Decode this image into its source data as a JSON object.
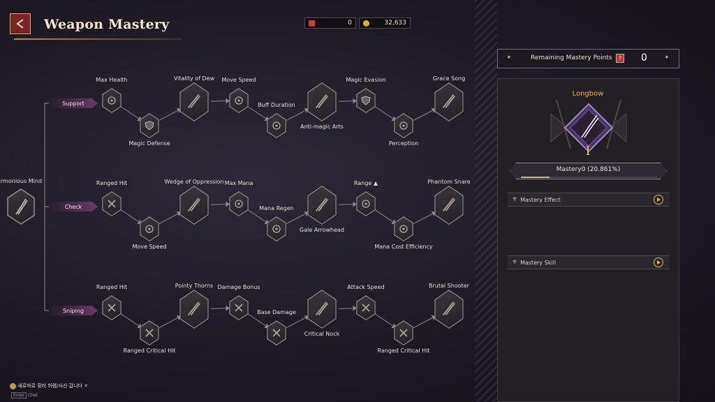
{
  "header": {
    "title": "Weapon Mastery"
  },
  "currencies": [
    {
      "icon": "feather-icon",
      "value": "0",
      "color": "#c04040"
    },
    {
      "icon": "gold-coin-icon",
      "value": "32,633",
      "color": "#d4b040"
    }
  ],
  "root_node": {
    "label": "armonious Mind",
    "icon": "longbow-skill-icon"
  },
  "branches": [
    {
      "label": "Support",
      "nodes": [
        {
          "label": "Max Health",
          "type": "small",
          "icon": "gear-icon"
        },
        {
          "label": "Magic Defense",
          "type": "small",
          "icon": "shield-icon"
        },
        {
          "label": "Vitality of Dew",
          "type": "large",
          "icon": "skill-art-icon"
        },
        {
          "label": "Move Speed",
          "type": "small",
          "icon": "gear-icon"
        },
        {
          "label": "Buff Duration",
          "type": "small",
          "icon": "gear-icon"
        },
        {
          "label": "Anti-magic Arts",
          "type": "large",
          "icon": "skill-art-icon"
        },
        {
          "label": "Magic Evasion",
          "type": "small",
          "icon": "shield-icon"
        },
        {
          "label": "Perception",
          "type": "small",
          "icon": "gear-icon"
        },
        {
          "label": "Grace Song",
          "type": "large",
          "icon": "skill-art-icon"
        }
      ]
    },
    {
      "label": "Check",
      "nodes": [
        {
          "label": "Ranged Hit",
          "type": "small",
          "icon": "crossed-arrows-icon"
        },
        {
          "label": "Move Speed",
          "type": "small",
          "icon": "gear-icon"
        },
        {
          "label": "Wedge of Oppression",
          "type": "large",
          "icon": "skill-art-icon"
        },
        {
          "label": "Max Mana",
          "type": "small",
          "icon": "gear-icon"
        },
        {
          "label": "Mana Regen",
          "type": "small",
          "icon": "gear-icon"
        },
        {
          "label": "Gale Arrowhead",
          "type": "large",
          "icon": "skill-art-icon"
        },
        {
          "label": "Range ▲",
          "type": "small",
          "icon": "gear-icon"
        },
        {
          "label": "Mana Cost Efficiency",
          "type": "small",
          "icon": "gear-icon"
        },
        {
          "label": "Phantom Snare",
          "type": "large",
          "icon": "skill-art-icon"
        }
      ]
    },
    {
      "label": "Sniping",
      "nodes": [
        {
          "label": "Ranged Hit",
          "type": "small",
          "icon": "crossed-arrows-icon"
        },
        {
          "label": "Ranged Critical Hit",
          "type": "small",
          "icon": "crossed-arrows-icon"
        },
        {
          "label": "Pointy Thorns",
          "type": "large",
          "icon": "skill-art-icon"
        },
        {
          "label": "Damage Bonus",
          "type": "small",
          "icon": "crossed-arrows-icon"
        },
        {
          "label": "Base Damage",
          "type": "small",
          "icon": "crossed-arrows-icon"
        },
        {
          "label": "Critical Nock",
          "type": "large",
          "icon": "skill-art-icon"
        },
        {
          "label": "Attack Speed",
          "type": "small",
          "icon": "crossed-arrows-icon"
        },
        {
          "label": "Ranged Critical Hit",
          "type": "small",
          "icon": "crossed-arrows-icon"
        },
        {
          "label": "Brutal Shooter",
          "type": "large",
          "icon": "skill-art-icon"
        }
      ]
    }
  ],
  "right_panel": {
    "points_label": "Remaining Mastery Points",
    "help_label": "?",
    "points_value": "0",
    "weapon_name": "Longbow",
    "rank": "I",
    "mastery_label": "Mastery0  (20.861%)",
    "mastery_progress": 0.20861,
    "effect_label": "Mastery Effect",
    "skill_label": "Mastery Skill"
  },
  "chat": {
    "message": "새로마로 횟러 하렴/사신 갑니다",
    "key_label": "Enter",
    "chat_label": "Chat"
  },
  "colors": {
    "accent": "#c9a87a",
    "branch": "#8a4a82",
    "progress": "#c8b890"
  }
}
